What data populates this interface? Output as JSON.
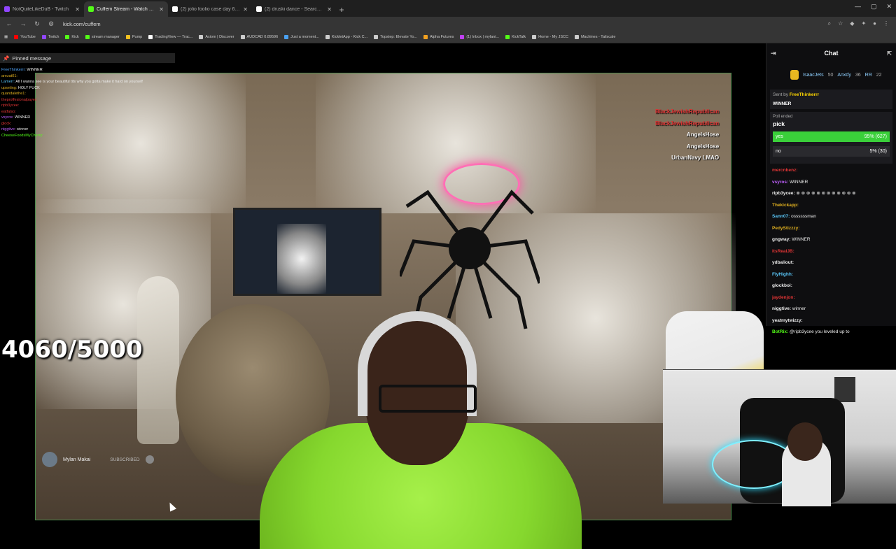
{
  "browser": {
    "tabs": [
      {
        "label": "NotQuiteLikeDuB - Twitch",
        "color": "#9146ff",
        "active": false
      },
      {
        "label": "Cuffem Stream - Watch Live",
        "color": "#53fc18",
        "active": true
      },
      {
        "label": "(2) jolio foolio case day 6 - Sea",
        "color": "#ffffff",
        "active": false
      },
      {
        "label": "(2) druski dance - Search / X",
        "color": "#ffffff",
        "active": false
      }
    ],
    "new_tab": "+",
    "url": "kick.com/cuffem",
    "bookmarks": [
      {
        "label": "YouTube",
        "color": "#ff0000"
      },
      {
        "label": "Twitch",
        "color": "#9146ff"
      },
      {
        "label": "Kick",
        "color": "#53fc18"
      },
      {
        "label": "stream manager",
        "color": "#53fc18"
      },
      {
        "label": "Pump",
        "color": "#f0c020"
      },
      {
        "label": "TradingView — Trac...",
        "color": "#ffffff"
      },
      {
        "label": "Axiom | Discover",
        "color": "#cccccc"
      },
      {
        "label": "AUDCAD 0.89596",
        "color": "#cccccc"
      },
      {
        "label": "Just a moment...",
        "color": "#4aa0f0"
      },
      {
        "label": "KickletApp - Kick C...",
        "color": "#cccccc"
      },
      {
        "label": "Topstep: Elevate Yo...",
        "color": "#cccccc"
      },
      {
        "label": "Alpha Futures",
        "color": "#f0a020"
      },
      {
        "label": "(1) Inbox | mylani...",
        "color": "#c040f0"
      },
      {
        "label": "KickTalk",
        "color": "#53fc18"
      },
      {
        "label": "Home - My JSCC",
        "color": "#cccccc"
      },
      {
        "label": "Machines - Tailscale",
        "color": "#cccccc"
      }
    ]
  },
  "stream": {
    "pinned_label": "Pinned message",
    "overlay_chat": [
      {
        "user": "FreeThinkerrr:",
        "text": "WINNER",
        "color": "#4fa7ff"
      },
      {
        "user": "arezat01:",
        "text": "",
        "color": "#e0b020"
      },
      {
        "user": "Lamerr:",
        "text": "All I wanna see is your beautiful tits why you gotta make it hard on yourself",
        "color": "#5ac8fa"
      },
      {
        "user": "upseting:",
        "text": "HOLY FUCK",
        "color": "#e0b020"
      },
      {
        "user": "quandalethe1:",
        "text": "",
        "color": "#e0b020"
      },
      {
        "user": "theproffesionalpayer:",
        "text": "",
        "color": "#e23535"
      },
      {
        "user": "ripb3ycee:",
        "text": "",
        "color": "#e23535"
      },
      {
        "user": "eatfalso:",
        "text": "",
        "color": "#e23535"
      },
      {
        "user": "vsyros:",
        "text": "WINNER",
        "color": "#c060ff"
      },
      {
        "user": "glock:",
        "text": "",
        "color": "#e23535"
      },
      {
        "user": "niggtive:",
        "text": "winner",
        "color": "#c060ff"
      },
      {
        "user": "CheeseFoodsMyCherry:",
        "text": "",
        "color": "#53fc18"
      }
    ],
    "counter": "4060/5000",
    "alerts": [
      {
        "text": "BlackJewishRepublican",
        "red": true
      },
      {
        "text": "BlackJewishRepublican",
        "red": true
      },
      {
        "text": "AngelsHose",
        "red": false
      },
      {
        "text": "AngelsHose",
        "red": false
      },
      {
        "text": "UrbanNavy LMAO",
        "red": false
      }
    ],
    "sub_bar": {
      "name": "Mylan Makai",
      "status": "SUBSCRIBED"
    }
  },
  "chat": {
    "title": "Chat",
    "leaderboard": [
      {
        "name": "IsaacJets",
        "count": "50"
      },
      {
        "name": "Anxdy",
        "count": "36"
      },
      {
        "name": "RR",
        "count": "22"
      }
    ],
    "pinned": {
      "sent_by_label": "Sent by",
      "sent_by": "FreeThinkerrr",
      "text": "WINNER"
    },
    "poll": {
      "status": "Poll ended",
      "question": "pick",
      "options": [
        {
          "label": "yes",
          "result": "95% (627)",
          "percent": 95
        },
        {
          "label": "no",
          "result": "5% (30)",
          "percent": 5
        }
      ]
    },
    "messages": [
      {
        "user": "mercnbenz:",
        "text": "",
        "color": "#e23535"
      },
      {
        "user": "vsyros:",
        "text": "WINNER",
        "color": "#c060ff"
      },
      {
        "user": "ripb3ycee:",
        "text": "⊗ ⊗ ⊗ ⊗ ⊗ ⊗ ⊗ ⊗ ⊗ ⊗ ⊗ ⊗",
        "color": "#eeeeee"
      },
      {
        "user": "Thekickapp:",
        "text": "",
        "color": "#e0b020"
      },
      {
        "user": "Sann07:",
        "text": "ossssssman",
        "color": "#5ac8fa"
      },
      {
        "user": "PedyStizzzy:",
        "text": "",
        "color": "#e0b020"
      },
      {
        "user": "gngway:",
        "text": "WINNER",
        "color": "#eeeeee"
      },
      {
        "user": "itsRealJB:",
        "text": "",
        "color": "#e23535"
      },
      {
        "user": "ydbaliout:",
        "text": "",
        "color": "#eeeeee"
      },
      {
        "user": "FlyHighh:",
        "text": "",
        "color": "#5ac8fa"
      },
      {
        "user": "glockboi:",
        "text": "",
        "color": "#eeeeee"
      },
      {
        "user": "jaydenjon:",
        "text": "",
        "color": "#e23535"
      },
      {
        "user": "niggtive:",
        "text": "winner",
        "color": "#eeeeee"
      },
      {
        "user": "yeatmytwizzy:",
        "text": "",
        "color": "#eeeeee"
      },
      {
        "user": "BotRix:",
        "text": "@ripb3ycee you leveled up to",
        "color": "#53fc18"
      }
    ]
  }
}
